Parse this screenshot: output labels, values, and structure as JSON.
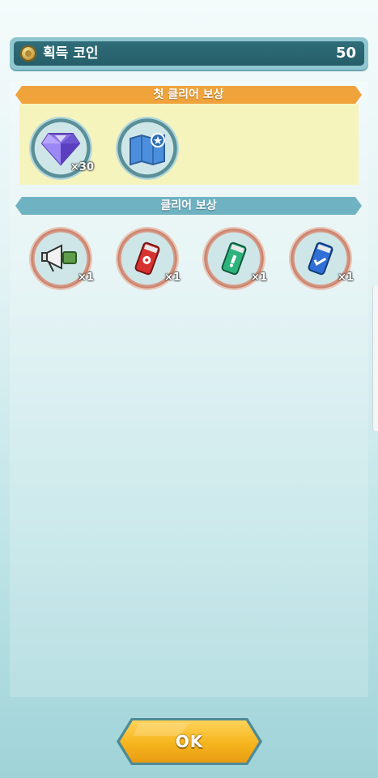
{
  "coin_bar": {
    "label": "획득 코인",
    "value": "50"
  },
  "first_clear": {
    "title": "첫 클리어 보상",
    "items": [
      {
        "icon": "diamond-icon",
        "qty": "×30"
      },
      {
        "icon": "map-icon",
        "qty": ""
      }
    ]
  },
  "clear_reward": {
    "title": "클리어 보상",
    "items": [
      {
        "icon": "megaphone-icon",
        "qty": "×1"
      },
      {
        "icon": "red-can-icon",
        "qty": "×1"
      },
      {
        "icon": "green-can-icon",
        "qty": "×1"
      },
      {
        "icon": "blue-can-icon",
        "qty": "×1"
      }
    ]
  },
  "ok_button": {
    "label": "OK"
  },
  "colors": {
    "first_ribbon": "#f0a33a",
    "clear_ribbon": "#6fb2c2",
    "ok_button": "#f6b51d"
  }
}
